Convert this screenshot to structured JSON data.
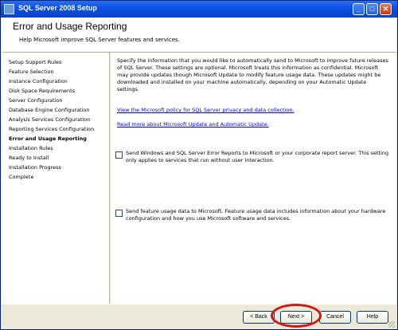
{
  "window": {
    "title": "SQL Server 2008 Setup",
    "minimize": "_",
    "maximize": "□",
    "close": "✕"
  },
  "header": {
    "title": "Error and Usage Reporting",
    "subtitle": "Help Microsoft improve SQL Server features and services."
  },
  "sidebar": {
    "items": [
      {
        "label": "Setup Support Rules"
      },
      {
        "label": "Feature Selection"
      },
      {
        "label": "Instance Configuration"
      },
      {
        "label": "Disk Space Requirements"
      },
      {
        "label": "Server Configuration"
      },
      {
        "label": "Database Engine Configuration"
      },
      {
        "label": "Analysis Services Configuration"
      },
      {
        "label": "Reporting Services Configuration"
      },
      {
        "label": "Error and Usage Reporting"
      },
      {
        "label": "Installation Rules"
      },
      {
        "label": "Ready to Install"
      },
      {
        "label": "Installation Progress"
      },
      {
        "label": "Complete"
      }
    ],
    "active_index": 8
  },
  "content": {
    "intro": "Specify the information that you would like to automatically send to Microsoft to improve future releases of SQL Server. These settings are optional. Microsoft treats this information as confidential. Microsoft may provide updates though Microsoft Update to modify feature usage data. These updates might be downloaded and installed on your machine automatically, depending on your Automatic Update settings.",
    "privacy_link": "View the Microsoft policy for SQL Server privacy and data collection.",
    "update_link": "Read more about Microsoft Update and Automatic Update.",
    "error_reports_label": "Send Windows and SQL Server Error Reports to Microsoft or your corporate report server. This setting only applies to services that run without user interaction.",
    "error_reports_checked": false,
    "feature_usage_label": "Send feature usage data to Microsoft. Feature usage data includes information about your hardware configuration and how you use Microsoft software and services.",
    "feature_usage_checked": false
  },
  "footer": {
    "back": "< Back",
    "next": "Next >",
    "cancel": "Cancel",
    "help": "Help"
  }
}
